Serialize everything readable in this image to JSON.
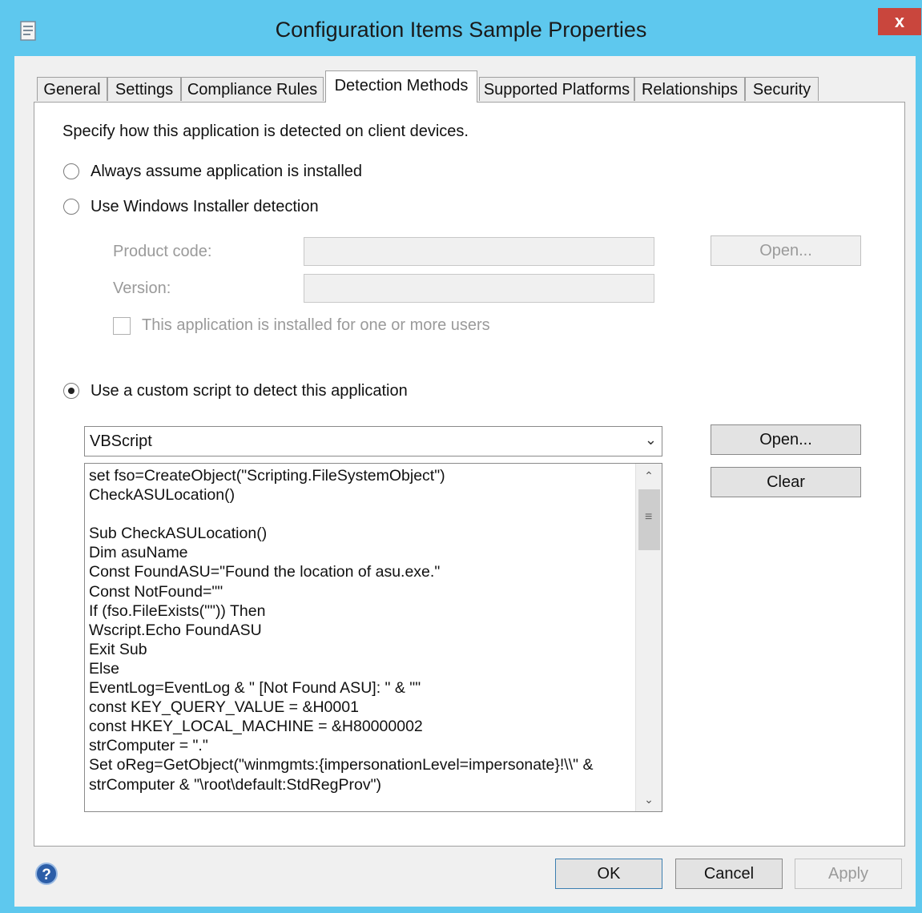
{
  "window": {
    "title": "Configuration Items Sample Properties",
    "close_label": "x"
  },
  "tabs": [
    {
      "label": "General"
    },
    {
      "label": "Settings"
    },
    {
      "label": "Compliance Rules"
    },
    {
      "label": "Detection Methods",
      "active": true
    },
    {
      "label": "Supported Platforms"
    },
    {
      "label": "Relationships"
    },
    {
      "label": "Security"
    }
  ],
  "detection": {
    "instruction": "Specify how this application is detected on client devices.",
    "options": {
      "always_label": "Always assume application is installed",
      "always_selected": false,
      "msi_label": "Use Windows Installer detection",
      "msi_selected": false,
      "script_label": "Use a custom script to detect this application",
      "script_selected": true
    },
    "msi": {
      "product_code_label": "Product code:",
      "product_code_value": "",
      "version_label": "Version:",
      "version_value": "",
      "installed_for_users_label": "This application is installed for one or more users",
      "installed_for_users_checked": false,
      "open_button_label": "Open..."
    },
    "script": {
      "language": "VBScript",
      "open_button_label": "Open...",
      "clear_button_label": "Clear",
      "code_lines": [
        "set fso=CreateObject(\"Scripting.FileSystemObject\")",
        "CheckASULocation()",
        "",
        "Sub CheckASULocation()",
        "Dim asuName",
        "Const FoundASU=\"Found the location of asu.exe.\"",
        "Const NotFound=\"\"",
        "If (fso.FileExists(\"\")) Then",
        "Wscript.Echo FoundASU",
        "Exit Sub",
        "Else",
        "EventLog=EventLog & \" [Not Found ASU]: \" & \"\"",
        "const KEY_QUERY_VALUE = &H0001",
        "const HKEY_LOCAL_MACHINE = &H80000002",
        "strComputer = \".\"",
        "Set oReg=GetObject(\"winmgmts:{impersonationLevel=impersonate}!\\\\\" &",
        "strComputer & \"\\root\\default:StdRegProv\")"
      ]
    }
  },
  "footer": {
    "ok_label": "OK",
    "cancel_label": "Cancel",
    "apply_label": "Apply"
  },
  "colors": {
    "title_bar": "#5ec8ee",
    "close_button": "#c9463d",
    "dialog_background": "#f0f0f0"
  }
}
